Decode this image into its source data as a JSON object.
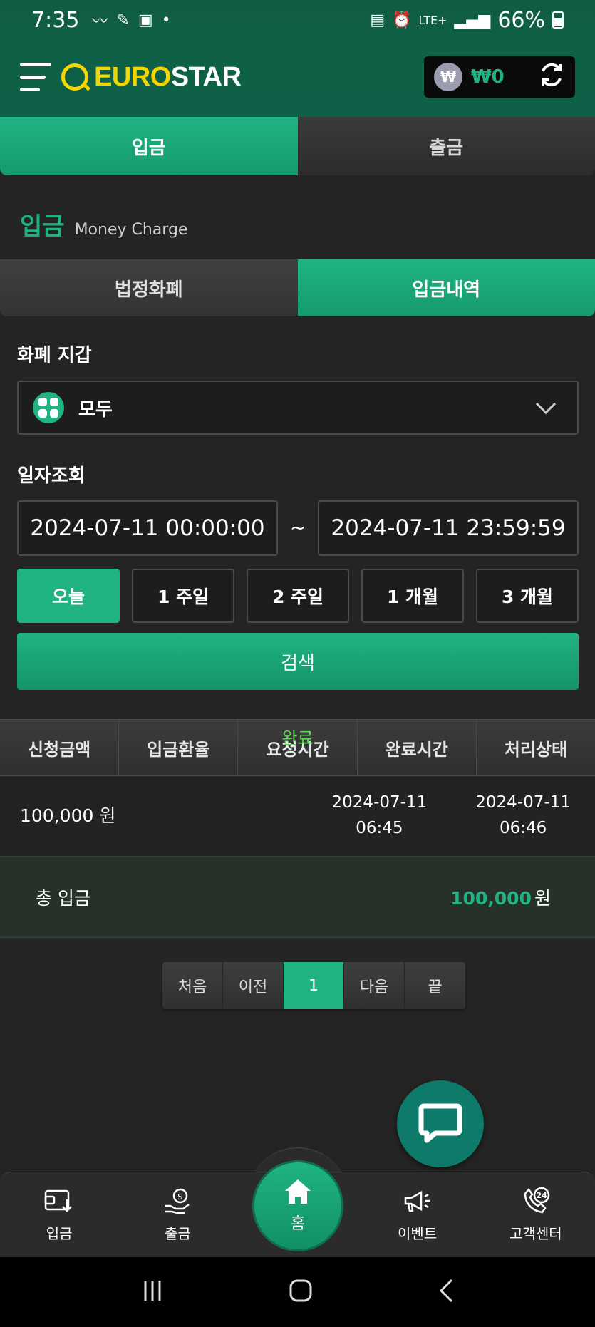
{
  "status_bar": {
    "time": "7:35",
    "network": "LTE+",
    "battery": "66%"
  },
  "header": {
    "logo_euro": "EURO",
    "logo_star": "STAR",
    "wallet_coin_symbol": "₩",
    "wallet_amount": "₩0"
  },
  "main_tabs": [
    {
      "label": "입금",
      "active": true
    },
    {
      "label": "출금",
      "active": false
    }
  ],
  "section": {
    "title": "입금",
    "subtitle": "Money Charge"
  },
  "sub_tabs": [
    {
      "label": "법정화폐",
      "active": false
    },
    {
      "label": "입금내역",
      "active": true
    }
  ],
  "wallet_filter": {
    "label": "화폐 지갑",
    "value": "모두"
  },
  "date_filter": {
    "label": "일자조회",
    "from": "2024-07-11 00:00:00",
    "separator": "~",
    "to": "2024-07-11 23:59:59"
  },
  "range_buttons": [
    {
      "label": "오늘",
      "active": true
    },
    {
      "label": "1 주일",
      "active": false
    },
    {
      "label": "2 주일",
      "active": false
    },
    {
      "label": "1 개월",
      "active": false
    },
    {
      "label": "3 개월",
      "active": false
    }
  ],
  "search_label": "검색",
  "table": {
    "headers": [
      "신청금액",
      "입금환율",
      "요청시간",
      "완료시간",
      "처리상태"
    ],
    "rows": [
      {
        "amount": "100,000 원",
        "rate": "",
        "request_date": "2024-07-11",
        "request_time": "06:45",
        "complete_date": "2024-07-11",
        "complete_time": "06:46",
        "status": "완료"
      }
    ]
  },
  "total": {
    "label": "총 입금",
    "amount": "100,000",
    "unit": "원"
  },
  "pagination": {
    "first": "처음",
    "prev": "이전",
    "current": "1",
    "next": "다음",
    "last": "끝"
  },
  "bottom_nav": {
    "deposit": "입금",
    "withdraw": "출금",
    "home": "홈",
    "event": "이벤트",
    "support": "고객센터",
    "support_badge": "24"
  },
  "colors": {
    "accent": "#1fb383",
    "header_bg": "#0f5e44",
    "status_complete": "#5fd25a",
    "logo_yellow": "#f5d500"
  }
}
